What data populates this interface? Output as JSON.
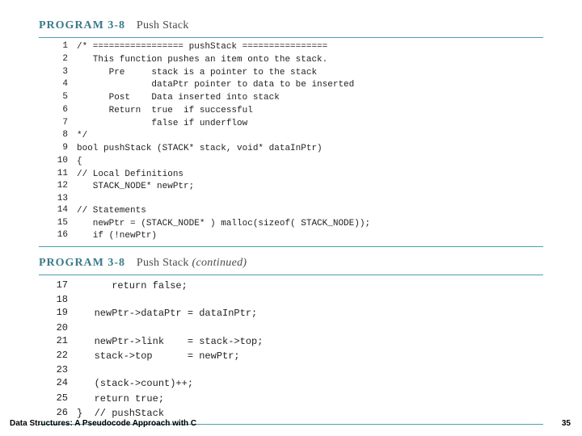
{
  "header1": {
    "label": "PROGRAM 3-8",
    "title": "Push Stack"
  },
  "code1": {
    "start": 1,
    "lines": [
      "/* ================= pushStack ================",
      "   This function pushes an item onto the stack.",
      "      Pre     stack is a pointer to the stack",
      "              dataPtr pointer to data to be inserted",
      "      Post    Data inserted into stack",
      "      Return  true  if successful",
      "              false if underflow",
      "*/",
      "bool pushStack (STACK* stack, void* dataInPtr)",
      "{",
      "// Local Definitions",
      "   STACK_NODE* newPtr;",
      "",
      "// Statements",
      "   newPtr = (STACK_NODE* ) malloc(sizeof( STACK_NODE));",
      "   if (!newPtr)"
    ]
  },
  "header2": {
    "label": "PROGRAM 3-8",
    "title": "Push Stack",
    "cont": "(continued)"
  },
  "code2": {
    "start": 17,
    "lines": [
      "      return false;",
      "",
      "   newPtr->dataPtr = dataInPtr;",
      "",
      "   newPtr->link    = stack->top;",
      "   stack->top      = newPtr;",
      "",
      "   (stack->count)++;",
      "   return true;",
      "}  // pushStack"
    ]
  },
  "footer": "Data Structures: A Pseudocode Approach with C",
  "pagenum": "35"
}
